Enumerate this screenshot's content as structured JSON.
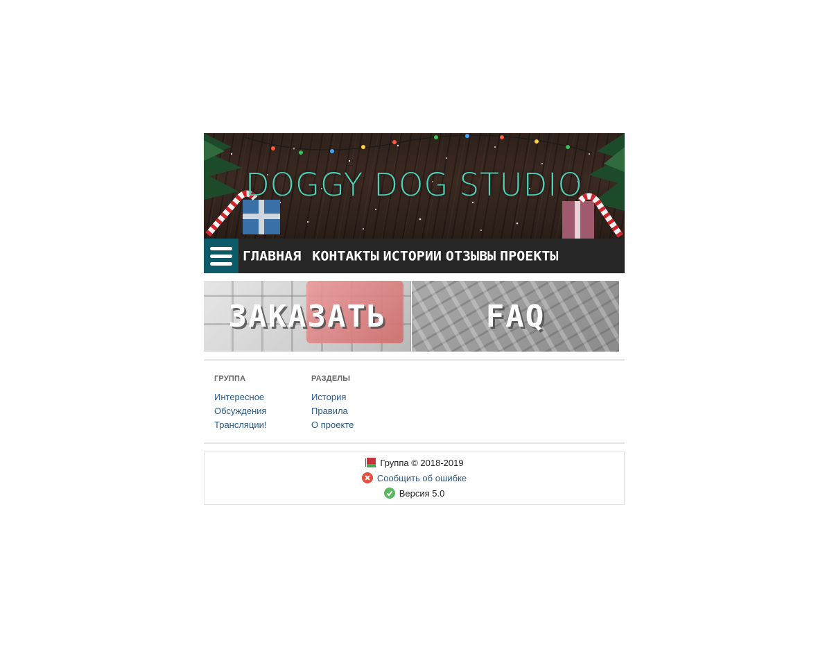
{
  "banner": {
    "title": "DOGGY DOG STUDIO"
  },
  "nav": {
    "menu_icon": "hamburger-icon",
    "items": [
      "ГЛАВНАЯ",
      "КОНТАКТЫ",
      "ИСТОРИИ",
      "ОТЗЫВЫ",
      "ПРОЕКТЫ"
    ]
  },
  "tiles": {
    "order": "ЗАКАЗАТЬ",
    "faq": "FAQ"
  },
  "footer_links": {
    "group": {
      "title": "ГРУППА",
      "items": [
        "Интересное",
        "Обсуждения",
        "Трансляции!"
      ]
    },
    "sections": {
      "title": "РАЗДЕЛЫ",
      "items": [
        "История",
        "Правила",
        "О проекте"
      ]
    }
  },
  "info": {
    "copyright": "Группа © 2018-2019",
    "report": "Сообщить об ошибке",
    "version": "Версия 5.0"
  },
  "colors": {
    "accent_teal": "#0d5b68",
    "title_teal": "#4fd0b8",
    "link": "#2a5885",
    "nav_bg": "#262626",
    "error_red": "#e74c3c",
    "ok_green": "#5cb85c"
  }
}
